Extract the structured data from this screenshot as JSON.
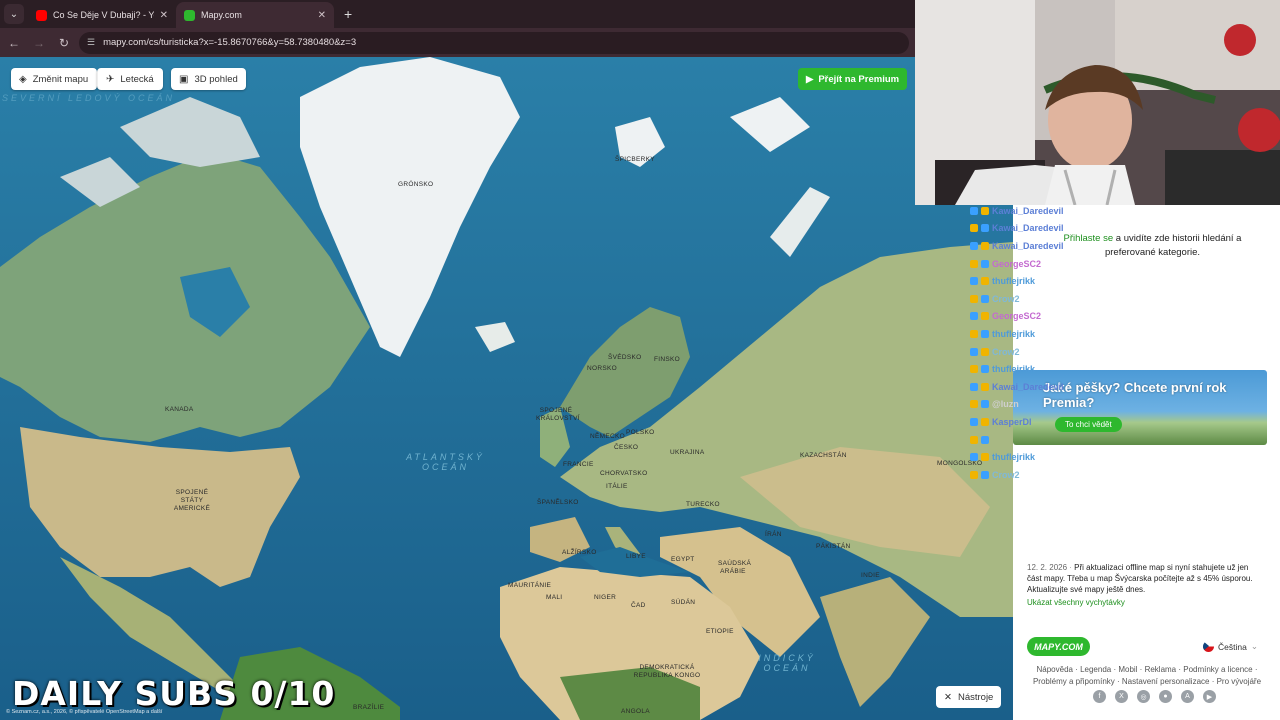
{
  "browser": {
    "tabs": [
      {
        "title": "Co Se Děje V Dubaji? - YouTube",
        "favicon_color": "#ff0000",
        "active": false
      },
      {
        "title": "Mapy.com",
        "favicon_color": "#2eb82e",
        "active": true
      }
    ],
    "url": "mapy.com/cs/turisticka?x=-15.8670766&y=58.7380480&z=3"
  },
  "map": {
    "controls": {
      "change_map": "Změnit mapu",
      "aerial": "Letecká",
      "view3d": "3D pohled",
      "premium": "Přejít na Premium",
      "tools": "Nástroje"
    },
    "labels": {
      "gronsko": "GRÓNSKO",
      "spicberky": "ŠPICBERKY",
      "kanada": "KANADA",
      "usa": "SPOJENÉ STÁTY AMERICKÉ",
      "norsko": "NORSKO",
      "svedsko": "ŠVÉDSKO",
      "finsko": "FINSKO",
      "uk": "SPOJENÉ KRÁLOVSTVÍ",
      "nemecko": "NĚMECKO",
      "polsko": "POLSKO",
      "cesko": "ČESKO",
      "ukrajina": "UKRAJINA",
      "francie": "FRANCIE",
      "chorvatsko": "CHORVATSKO",
      "italie": "ITÁLIE",
      "spanelsko": "ŠPANĚLSKO",
      "turecko": "TURECKO",
      "kazachstan": "KAZACHSTÁN",
      "mongolsko": "MONGOLSKO",
      "iran": "ÍRÁN",
      "pakistan": "PÁKISTÁN",
      "indie": "INDIE",
      "alzirsko": "ALŽÍRSKO",
      "libye": "LIBYE",
      "egypt": "EGYPT",
      "saudska": "SAÚDSKÁ ARÁBIE",
      "mauritanie": "MAURITÁNIE",
      "mali": "MALI",
      "niger": "NIGER",
      "cad": "ČAD",
      "sudan": "SÚDÁN",
      "etiopie": "ETIOPIE",
      "kongo": "DEMOKRATICKÁ REPUBLIKA KONGO",
      "brazilie": "BRAZÍLIE",
      "angola": "ANGOLA",
      "atlantic": "ATLANTSKÝ OCEÁN",
      "indian": "INDICKÝ OCEÁN",
      "arctic": "SEVERNÍ LEDOVÝ OCEÁN"
    },
    "copyright": "© Seznam.cz, a.s., 2026, © přispěvatelé OpenStreetMap a další",
    "overlay": "DAILY SUBS 0/10"
  },
  "sidebar": {
    "login_link": "Přihlaste se",
    "login_rest": " a uvidíte zde historii hledání a preferované kategorie.",
    "promo_title": "Jaké pěšky? Chcete první rok Premia?",
    "promo_button": "To chci vědět",
    "news_date": "12. 2. 2026",
    "news_text": "Při aktualizaci offline map si nyní stahujete už jen část mapy. Třeba u map Švýcarska počítejte až s 45% úsporou. Aktualizujte své mapy ještě dnes.",
    "news_all": "Ukázat všechny vychytávky",
    "logo": "MAPY.COM",
    "language": "Čeština",
    "footer_links": "Nápověda · Legenda · Mobil · Reklama · Podmínky a licence · Problémy a připomínky · Nastavení personalizace · Pro vývojáře"
  },
  "chat": {
    "messages": [
      {
        "user": "Kawai_Daredevil",
        "text": "",
        "color": "#5c7fd6"
      },
      {
        "user": "Kawai_Daredevil",
        "text": "",
        "color": "#5c7fd6"
      },
      {
        "user": "Kawai_Daredevil",
        "text": "",
        "color": "#5c7fd6"
      },
      {
        "user": "GeorgeSC2",
        "text": "",
        "color": "#c46ad0"
      },
      {
        "user": "thuflejrikk",
        "text": "",
        "color": "#4f9bd9"
      },
      {
        "user": "Crow2",
        "text": "",
        "color": "#7fb8d8"
      },
      {
        "user": "GeorgeSC2",
        "text": "",
        "color": "#c46ad0"
      },
      {
        "user": "thuflejrikk",
        "text": "",
        "color": "#4f9bd9"
      },
      {
        "user": "Crow2",
        "text": "",
        "color": "#7fb8d8"
      },
      {
        "user": "thuflejrikk",
        "text": "",
        "color": "#4f9bd9"
      },
      {
        "user": "Kawai_Daredevil",
        "text": "",
        "color": "#5c7fd6"
      },
      {
        "user": "@luzn",
        "text": "",
        "color": "#cfcfcf"
      },
      {
        "user": "KasperDl",
        "text": "",
        "color": "#5c7fd6"
      },
      {
        "user": "",
        "text": "",
        "color": "#cfcfcf"
      },
      {
        "user": "thuflejrikk",
        "text": "",
        "color": "#4f9bd9"
      },
      {
        "user": "Crow2",
        "text": "",
        "color": "#7fb8d8"
      }
    ]
  }
}
